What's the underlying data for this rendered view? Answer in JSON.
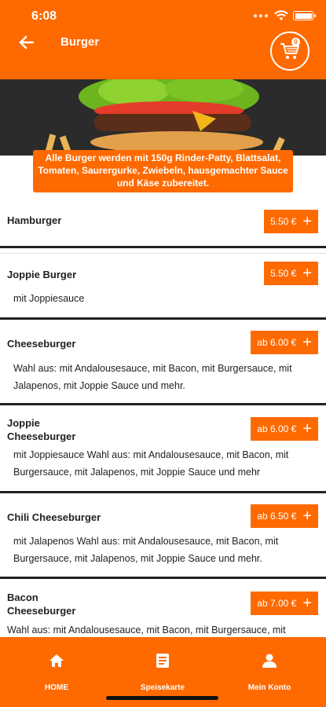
{
  "status_bar": {
    "time": "6:08"
  },
  "header": {
    "title": "Burger",
    "cart_count": "0"
  },
  "banner": {
    "text": "Alle Burger werden mit 150g Rinder-Patty, Blattsalat, Tomaten, Saurergurke, Zwiebeln, hausgemachter Sauce und Käse zubereitet."
  },
  "items": [
    {
      "name": "Hamburger",
      "price": "5.50 €",
      "desc": ""
    },
    {
      "name": "Joppie Burger",
      "price": "5.50 €",
      "desc": "mit Joppiesauce"
    },
    {
      "name": "Cheeseburger",
      "price": "ab 6.00 €",
      "desc": "Wahl aus: mit Andalousesauce, mit Bacon, mit Burgersauce, mit Jalapenos, mit Joppie Sauce und mehr."
    },
    {
      "name": "Joppie Cheeseburger",
      "price": "ab 6.00 €",
      "desc": "mit Joppiesauce Wahl aus: mit Andalousesauce, mit Bacon, mit Burgersauce, mit Jalapenos, mit Joppie Sauce und mehr"
    },
    {
      "name": "Chili Cheeseburger",
      "price": "ab 6.50 €",
      "desc": "mit Jalapenos Wahl aus: mit Andalousesauce, mit Bacon, mit Burgersauce, mit Jalapenos, mit Joppie Sauce und mehr."
    },
    {
      "name": "Bacon Cheeseburger",
      "price": "ab 7.00 €",
      "desc": "Wahl aus: mit Andalousesauce, mit Bacon, mit Burgersauce, mit"
    }
  ],
  "nav": {
    "home": "HOME",
    "menu": "Speisekarte",
    "account": "Mein Konto"
  },
  "colors": {
    "accent": "#ff6a00",
    "text": "#222222"
  }
}
